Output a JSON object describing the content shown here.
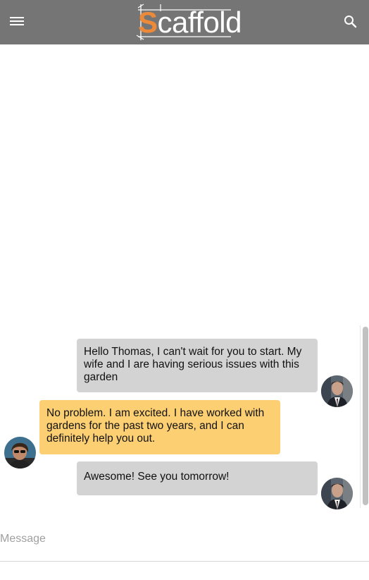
{
  "app": {
    "logo_initial": "S",
    "logo_rest": "caffold",
    "accent_color": "#ec8a3a",
    "appbar_color": "#757575",
    "menu_icon": "menu-icon",
    "search_icon": "search-icon"
  },
  "messages": [
    {
      "sender": "thomas",
      "side": "right",
      "text": "Hello Thomas, I can't wait for you to start. My wife and I are having serious issues with this garden"
    },
    {
      "sender": "gardener",
      "side": "left",
      "text": "No problem. I am excited. I have worked with gardens for the past two years, and I can definitely help you out."
    },
    {
      "sender": "thomas",
      "side": "right",
      "text": "Awesome! See you tomorrow!"
    }
  ],
  "colors": {
    "outgoing_bubble": "#d3d3d3",
    "incoming_bubble": "#fccf73"
  },
  "composer": {
    "placeholder": "Message",
    "value": ""
  }
}
